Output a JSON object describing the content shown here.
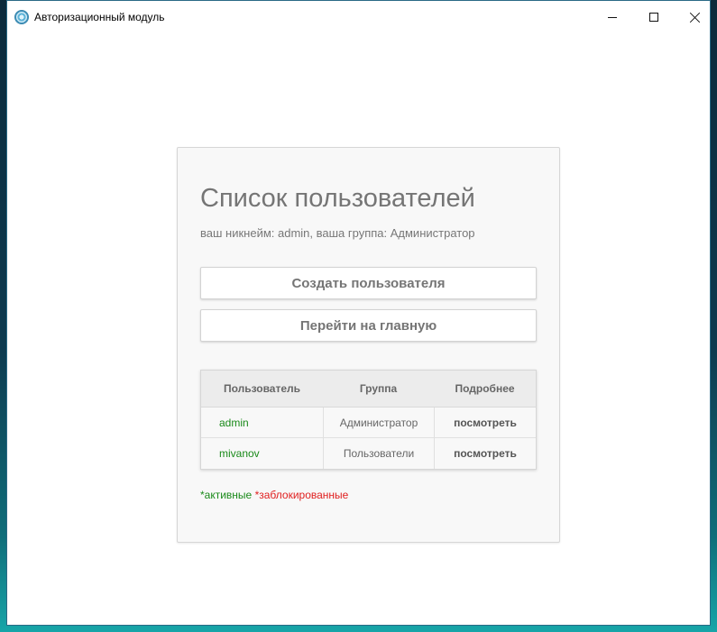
{
  "window": {
    "title": "Авторизационный модуль"
  },
  "card": {
    "title": "Список пользователей",
    "subtitle": "ваш никнейм: admin, ваша группа: Администратор",
    "create_user_label": "Создать пользователя",
    "go_home_label": "Перейти на главную"
  },
  "table": {
    "headers": [
      "Пользователь",
      "Группа",
      "Подробнее"
    ],
    "rows": [
      {
        "user": "admin",
        "group": "Администратор",
        "details": "посмотреть",
        "status": "active"
      },
      {
        "user": "mivanov",
        "group": "Пользователи",
        "details": "посмотреть",
        "status": "active"
      }
    ]
  },
  "legend": {
    "active": "*активные",
    "blocked": "*заблокированные"
  },
  "colors": {
    "active": "#1a8a1a",
    "blocked": "#e02020",
    "text_muted": "#757575"
  },
  "icons": {
    "app": "app-globe-icon",
    "minimize": "minimize-icon",
    "maximize": "maximize-icon",
    "close": "close-icon"
  }
}
